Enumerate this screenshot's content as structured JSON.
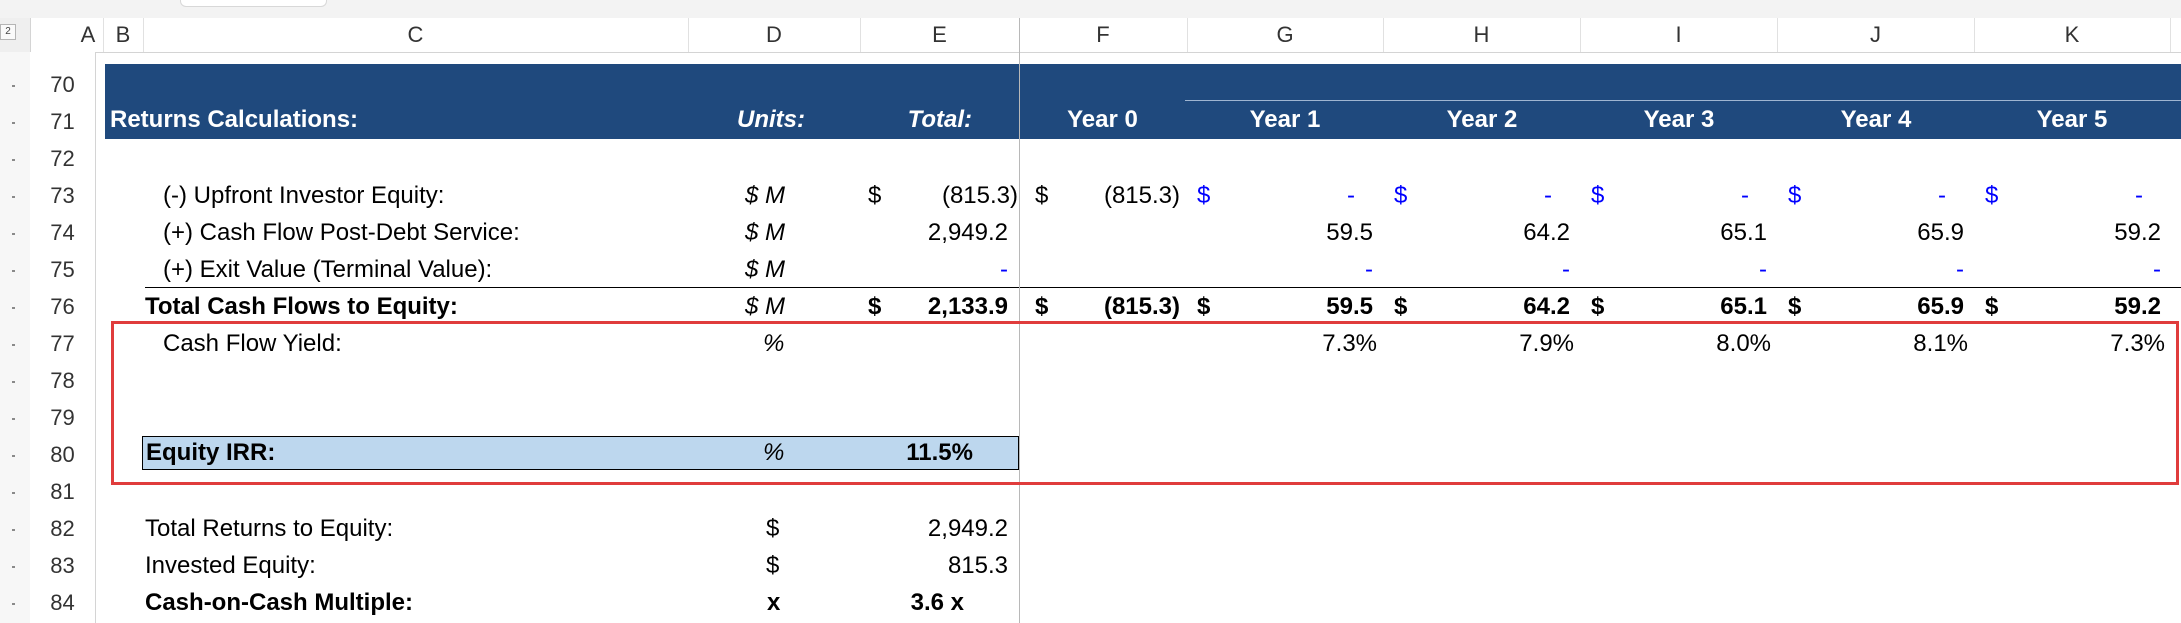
{
  "columns": [
    "A",
    "B",
    "C",
    "D",
    "E",
    "F",
    "G",
    "H",
    "I",
    "J",
    "K"
  ],
  "rows": [
    "70",
    "71",
    "72",
    "73",
    "74",
    "75",
    "76",
    "77",
    "78",
    "79",
    "80",
    "81",
    "82",
    "83",
    "84"
  ],
  "outline_level": "2",
  "colors": {
    "header_band": "#1f497d",
    "irr_fill": "#bdd7ee",
    "input_blue": "#0000ff",
    "highlight_border": "#e03c3c"
  },
  "header": {
    "title": "Returns Calculations:",
    "units": "Units:",
    "total": "Total:",
    "years": [
      "Year 0",
      "Year 1",
      "Year 2",
      "Year 3",
      "Year 4",
      "Year 5"
    ]
  },
  "lines": {
    "upfront": {
      "label": "(-) Upfront Investor Equity:",
      "unit": "$ M",
      "total_sym": "$",
      "total": "(815.3)",
      "y0_sym": "$",
      "y0": "(815.3)",
      "year_sym": "$",
      "years": [
        "-",
        "-",
        "-",
        "-",
        "-"
      ]
    },
    "cash_flow": {
      "label": "(+) Cash Flow Post-Debt Service:",
      "unit": "$ M",
      "total": "2,949.2",
      "years": [
        "59.5",
        "64.2",
        "65.1",
        "65.9",
        "59.2"
      ]
    },
    "exit": {
      "label": "(+) Exit Value (Terminal Value):",
      "unit": "$ M",
      "total": "-",
      "years": [
        "-",
        "-",
        "-",
        "-",
        "-"
      ]
    },
    "total_cf": {
      "label": "Total Cash Flows to Equity:",
      "unit": "$ M",
      "total_sym": "$",
      "total": "2,133.9",
      "y0_sym": "$",
      "y0": "(815.3)",
      "year_sym": "$",
      "years": [
        "59.5",
        "64.2",
        "65.1",
        "65.9",
        "59.2"
      ]
    },
    "yield": {
      "label": "Cash Flow Yield:",
      "unit": "%",
      "years": [
        "7.3%",
        "7.9%",
        "8.0%",
        "8.1%",
        "7.3%"
      ]
    },
    "irr": {
      "label": "Equity IRR:",
      "unit": "%",
      "total": "11.5%"
    },
    "returns": {
      "label": "Total Returns to Equity:",
      "unit": "$",
      "total": "2,949.2"
    },
    "invested": {
      "label": "Invested Equity:",
      "unit": "$",
      "total": "815.3"
    },
    "coc": {
      "label": "Cash-on-Cash Multiple:",
      "unit": "x",
      "total": "3.6 x"
    }
  }
}
